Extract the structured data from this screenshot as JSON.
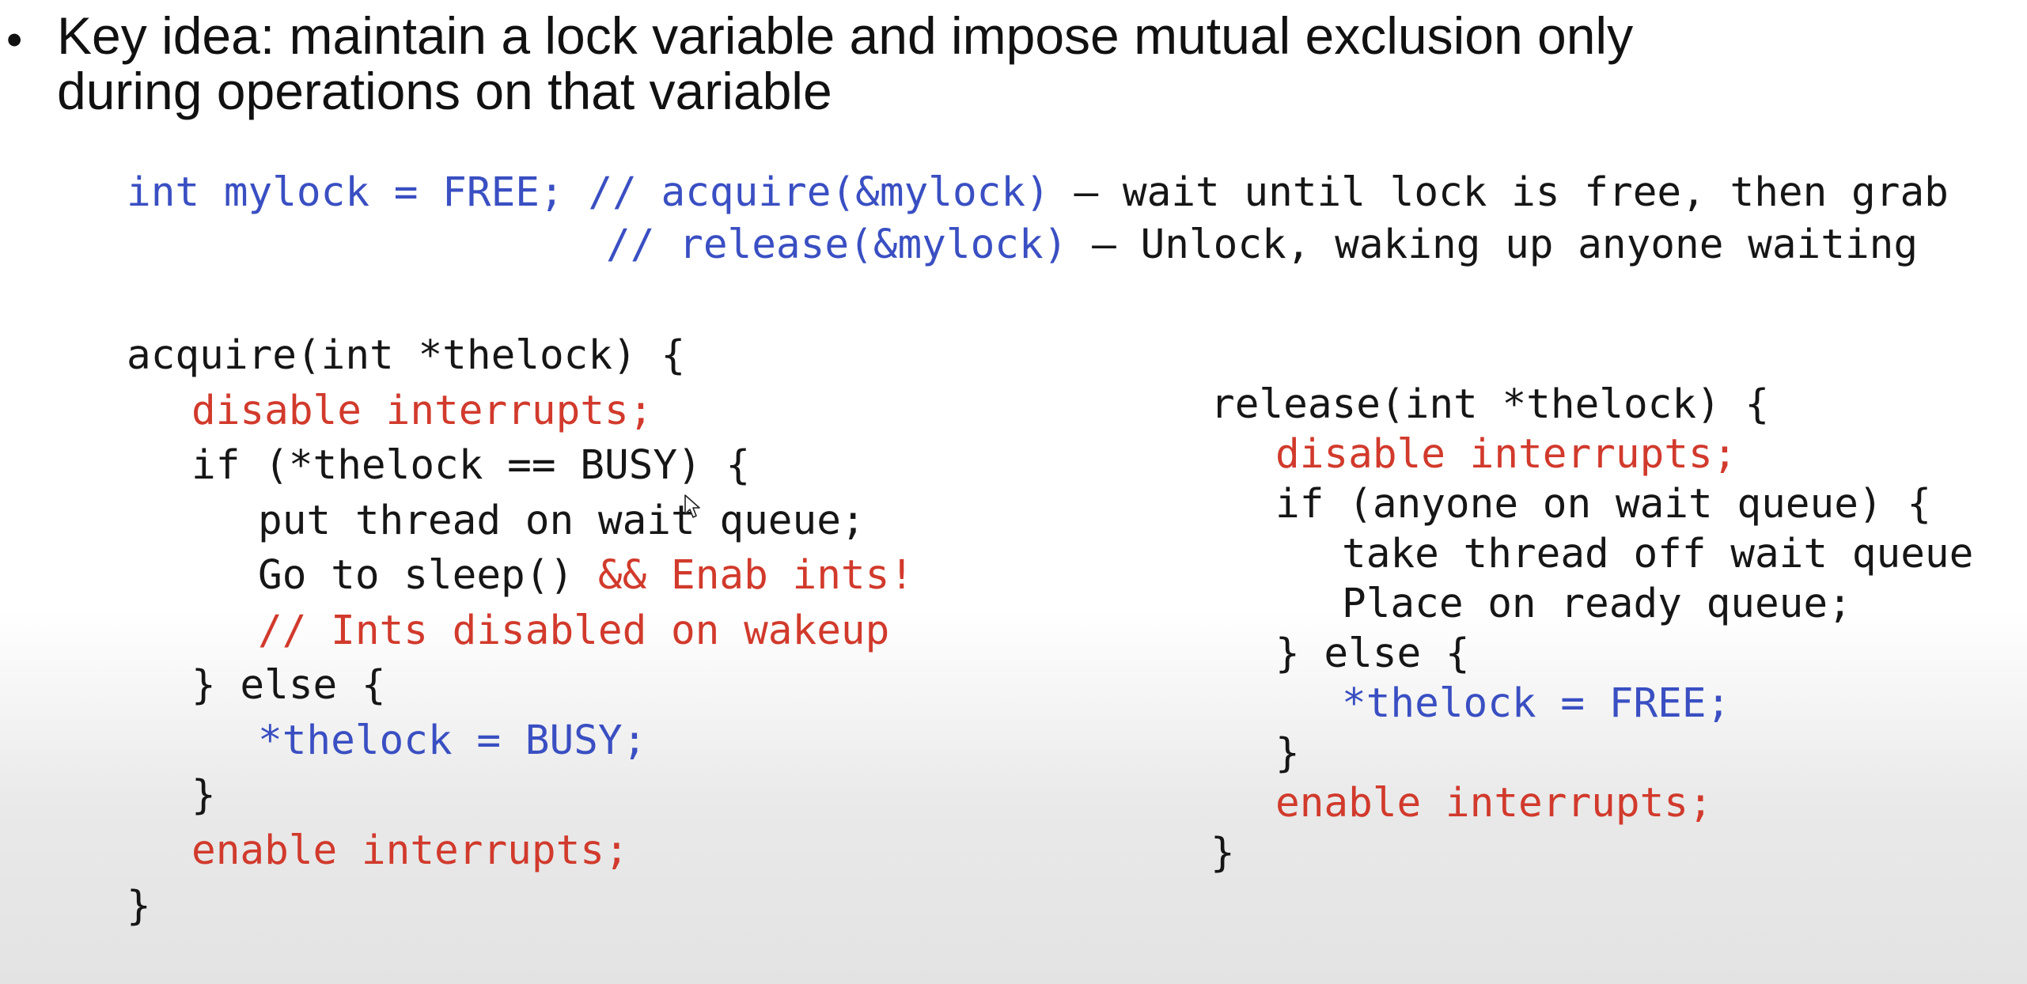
{
  "slide": {
    "bullet_symbol": "•",
    "heading_line1": "Key idea: maintain a lock variable and impose mutual exclusion only",
    "heading_line2": "during operations on that variable"
  },
  "top_code": {
    "line1_decl": "int mylock = FREE;",
    "line1_comment": "// acquire(&mylock)",
    "line1_desc": " – wait until lock is free, then grab",
    "line2_comment": "// release(&mylock)",
    "line2_desc": " – Unlock, waking up anyone waiting"
  },
  "acquire_code": {
    "header": "acquire(int *thelock) {",
    "disable": "disable interrupts;",
    "if_line": "if (*thelock == BUSY) {",
    "put_thread": "put thread on wait queue;",
    "go_sleep": "Go to sleep()",
    "enab_ints": " && Enab ints!",
    "ints_comment": "// Ints disabled on wakeup",
    "else_line": "} else {",
    "set_busy": "*thelock = BUSY;",
    "close_if": "}",
    "enable": "enable interrupts;",
    "close_fn": "}"
  },
  "release_code": {
    "header": "release(int *thelock) {",
    "disable": "disable interrupts;",
    "if_line": "if (anyone on wait queue) {",
    "take_thread": "take thread off wait queue",
    "place_ready": "Place on ready queue;",
    "else_line": "} else {",
    "set_free": "*thelock = FREE;",
    "close_if": "}",
    "enable": "enable interrupts;",
    "close_fn": "}"
  },
  "colors": {
    "keyword_blue": "#3a4fc2",
    "interrupt_red": "#d13a2c",
    "text_black": "#161616"
  },
  "icons": {
    "cursor": "mouse-pointer-icon"
  }
}
